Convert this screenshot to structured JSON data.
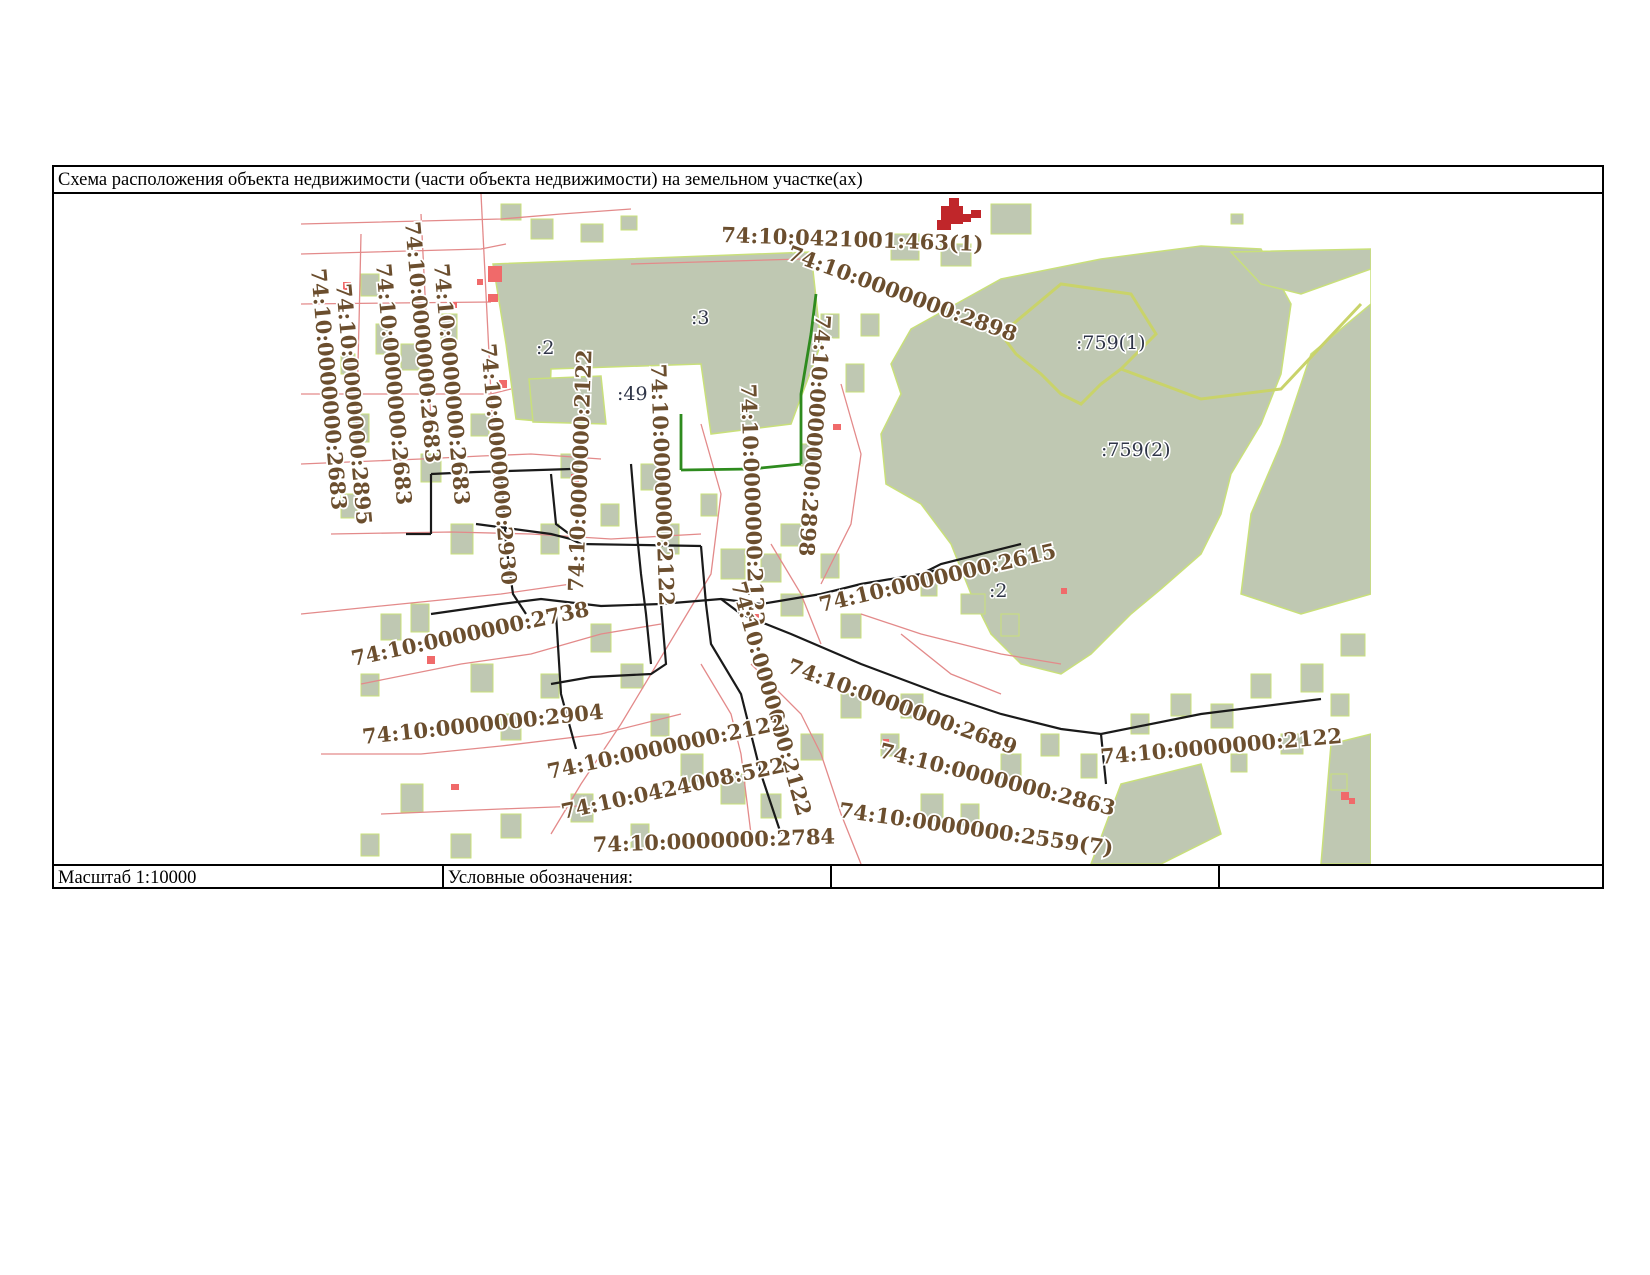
{
  "header": {
    "title": "Схема расположения объекта недвижимости (части объекта недвижимости) на земельном участке(ах)"
  },
  "footer": {
    "scale": "Масштаб 1:10000",
    "legend_label": "Условные обозначения:",
    "cell3": "",
    "cell4": ""
  },
  "map": {
    "colors": {
      "parcel_fill": "#bfc8b2",
      "parcel_stroke": "#c9e07a",
      "boundary_line": "#e38a8a",
      "building": "#f06a6a",
      "object_line": "#1a1a1a",
      "highlight_line": "#2e8b1e",
      "label_text": "#6b4e2e",
      "red_object": "#c0262a"
    },
    "labels": {
      "l463": "74:10:0421001:463(1)",
      "l2898a": "74:10:0000000:2898",
      "l2898b": "74:10:0000000:2898",
      "l3": ":3",
      "l2a": ":2",
      "l49": ":49",
      "l759_1": ":759(1)",
      "l759_2": ":759(2)",
      "l2615": "74:10:0000000:2615",
      "l2b": ":2",
      "l2683a": "74:10:0000000:2683",
      "l2683b": "74:10:0000000:2683",
      "l2683c": "74:10:0000000:2683",
      "l2683d": "74:10:0000000:2683",
      "l2895": "74:10:0000000:2895",
      "l2930": "74:10:0000000:2930",
      "l2122a": "74:10:0000000:2122",
      "l2122b": "74:10:0000000:2122",
      "l2122c": "74:10:0000000:2122",
      "l2122d": "74:10:0000000:2122",
      "l2122e": "74:10:0000000:2122",
      "l2122f": "74:10:0000000:2122",
      "l2738": "74:10:0000000:2738",
      "l2904": "74:10:0000000:2904",
      "l2689": "74:10:0000000:2689",
      "l522": "74:10:0424008:522",
      "l2863": "74:10:0000000:2863",
      "l2559": "74:10:0000000:2559(7)",
      "l2784": "74:10:0000000:2784"
    }
  }
}
